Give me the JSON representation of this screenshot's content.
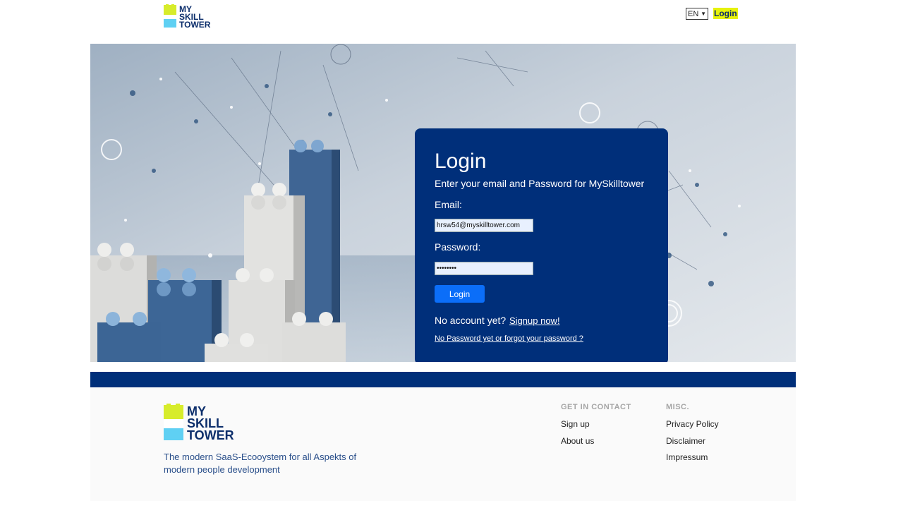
{
  "header": {
    "logo": {
      "lines": [
        "MY",
        "SKILL",
        "TOWER"
      ],
      "colors": {
        "green": "#d7ec2b",
        "blue": "#5fd0f3",
        "navy": "#0c2e6b"
      }
    },
    "language": {
      "selected": "EN"
    },
    "login_label": "Login"
  },
  "login": {
    "title": "Login",
    "subtitle": "Enter your email and Password for MySkilltower",
    "email_label": "Email:",
    "email_value": "hrsw54@myskilltower.com",
    "password_label": "Password:",
    "password_value": "password",
    "submit_label": "Login",
    "no_account_text": "No account yet?",
    "signup_label": "Signup now!",
    "forgot_label": "No Password yet or forgot your password ?"
  },
  "footer": {
    "tagline": "The modern SaaS-Ecooystem for all Aspekts of modern people development",
    "contact": {
      "heading": "GET IN CONTACT",
      "links": [
        "Sign up",
        "About us"
      ]
    },
    "misc": {
      "heading": "MISC.",
      "links": [
        "Privacy Policy",
        "Disclaimer",
        "Impressum"
      ]
    }
  },
  "colors": {
    "navy": "#002f7a",
    "button_blue": "#0b6ef9",
    "highlight": "#e6f20a",
    "tagline": "#2a4f8a"
  }
}
